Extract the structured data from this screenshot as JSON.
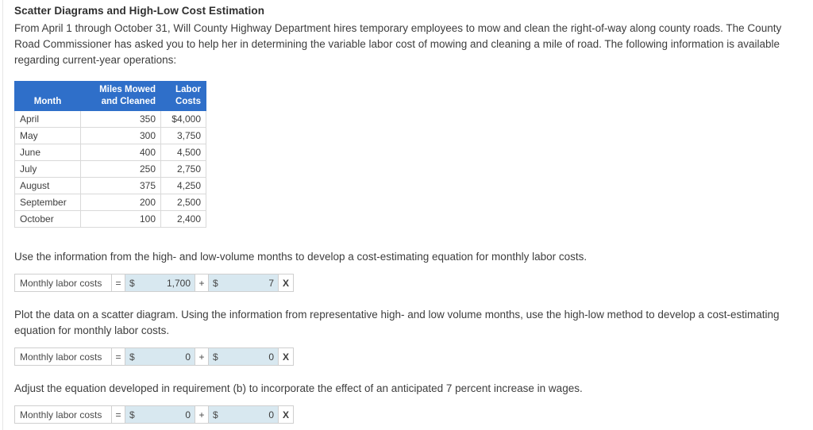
{
  "heading": "Scatter Diagrams and High-Low Cost Estimation",
  "intro": "From April 1 through October 31, Will County Highway Department hires temporary employees to mow and clean the right-of-way along county roads. The County Road Commissioner has asked you to help her in determining the variable labor cost of mowing and cleaning a mile of road. The following information is available regarding current-year operations:",
  "colors": {
    "table_header_bg": "#2f6fc9",
    "input_bg": "#d8e8f0",
    "text": "#3d3d3d"
  },
  "table": {
    "headers": {
      "month": "Month",
      "miles_line1": "Miles Mowed",
      "miles_line2": "and Cleaned",
      "labor_line1": "Labor",
      "labor_line2": "Costs"
    },
    "rows": [
      {
        "month": "April",
        "miles": "350",
        "cost": "$4,000"
      },
      {
        "month": "May",
        "miles": "300",
        "cost": "3,750"
      },
      {
        "month": "June",
        "miles": "400",
        "cost": "4,500"
      },
      {
        "month": "July",
        "miles": "250",
        "cost": "2,750"
      },
      {
        "month": "August",
        "miles": "375",
        "cost": "4,250"
      },
      {
        "month": "September",
        "miles": "200",
        "cost": "2,500"
      },
      {
        "month": "October",
        "miles": "100",
        "cost": "2,400"
      }
    ]
  },
  "sections": [
    {
      "prompt": "Use the information from the high- and low-volume months to develop a cost-estimating equation for monthly labor costs.",
      "answer": {
        "label": "Monthly labor costs",
        "equals": "=",
        "dollar1": "$",
        "value1": "1,700",
        "operator": "+",
        "dollar2": "$",
        "value2": "7",
        "clear": "X"
      }
    },
    {
      "prompt": "Plot the data on a scatter diagram. Using the information from representative high- and low volume months, use the high-low method to develop a cost-estimating equation for monthly labor costs.",
      "answer": {
        "label": "Monthly labor costs",
        "equals": "=",
        "dollar1": "$",
        "value1": "0",
        "operator": "+",
        "dollar2": "$",
        "value2": "0",
        "clear": "X"
      }
    },
    {
      "prompt": "Adjust the equation developed in requirement (b) to incorporate the effect of an anticipated 7 percent increase in wages.",
      "answer": {
        "label": "Monthly labor costs",
        "equals": "=",
        "dollar1": "$",
        "value1": "0",
        "operator": "+",
        "dollar2": "$",
        "value2": "0",
        "clear": "X"
      }
    }
  ]
}
